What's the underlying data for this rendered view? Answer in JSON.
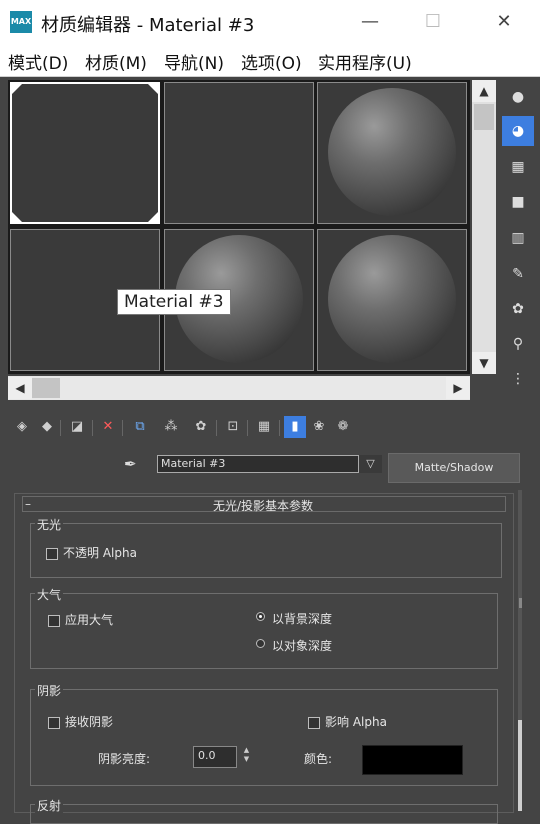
{
  "window": {
    "title": "材质编辑器 - Material #3",
    "minimize": "—",
    "maximize": "☐",
    "close": "✕"
  },
  "menu": [
    {
      "label": "模式(D)"
    },
    {
      "label": "材质(M)"
    },
    {
      "label": "导航(N)"
    },
    {
      "label": "选项(O)"
    },
    {
      "label": "实用程序(U)"
    }
  ],
  "slots": {
    "tooltip": "Material #3",
    "active_slot": 1
  },
  "scroll": {
    "up": "▲",
    "down": "▼",
    "left": "◀",
    "right": "▶"
  },
  "material": {
    "name": "Material #3",
    "type_button": "Matte/Shadow"
  },
  "rollout": {
    "title": "无光/投影基本参数",
    "collapse": "–",
    "matte": {
      "label": "无光",
      "opaque_alpha": {
        "label": "不透明 Alpha",
        "checked": false
      }
    },
    "atmosphere": {
      "label": "大气",
      "apply": {
        "label": "应用大气",
        "checked": false
      },
      "options": [
        {
          "label": "以背景深度",
          "selected": true
        },
        {
          "label": "以对象深度",
          "selected": false
        }
      ]
    },
    "shadow": {
      "label": "阴影",
      "receive": {
        "label": "接收阴影",
        "checked": false
      },
      "affect_alpha": {
        "label": "影响 Alpha",
        "checked": false
      },
      "brightness_label": "阴影亮度:",
      "brightness_value": "0.0",
      "color_label": "颜色:",
      "color": "#000000"
    },
    "reflection": {
      "label": "反射"
    }
  }
}
